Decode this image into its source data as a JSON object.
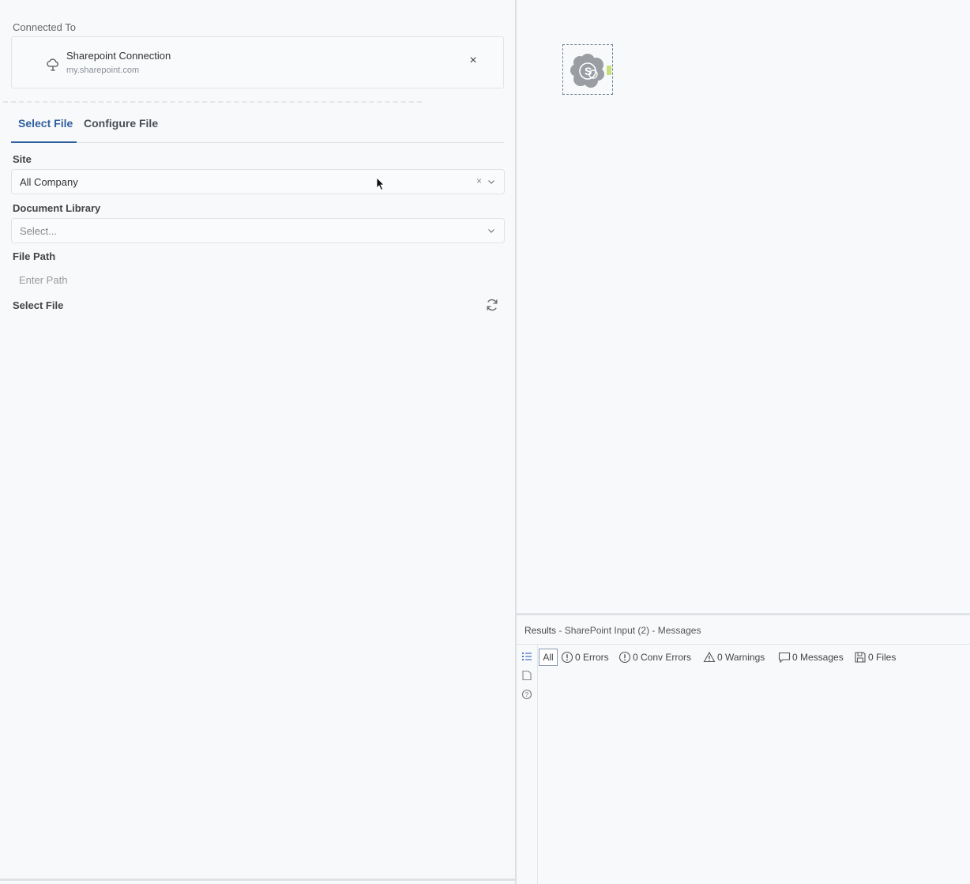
{
  "connection": {
    "section_label": "Connected To",
    "name": "Sharepoint Connection",
    "url": "my.sharepoint.com",
    "close_glyph": "×",
    "icon": "cloud-connection-icon"
  },
  "tabs": [
    {
      "label": "Select File",
      "active": true
    },
    {
      "label": "Configure File",
      "active": false
    }
  ],
  "form": {
    "site": {
      "label": "Site",
      "value": "All Company",
      "clear_glyph": "×"
    },
    "document_library": {
      "label": "Document Library",
      "placeholder": "Select..."
    },
    "file_path": {
      "label": "File Path",
      "placeholder": "Enter Path",
      "value": ""
    },
    "select_file": {
      "label": "Select File",
      "icon": "refresh-icon"
    }
  },
  "canvas": {
    "tool": {
      "name": "sharepoint-input-tool",
      "icon": "sharepoint-cloud-icon",
      "glyph": "S",
      "anchor_color": "#c8e07a"
    }
  },
  "results": {
    "title": "Results",
    "subtitle": "- SharePoint Input (2) - Messages",
    "filters": [
      {
        "key": "all",
        "label": "All",
        "icon": "none"
      },
      {
        "key": "errors",
        "label": "0 Errors",
        "icon": "error-circle-icon"
      },
      {
        "key": "conv_errors",
        "label": "0 Conv Errors",
        "icon": "conv-error-circle-icon"
      },
      {
        "key": "warnings",
        "label": "0 Warnings",
        "icon": "warning-triangle-icon"
      },
      {
        "key": "messages",
        "label": "0 Messages",
        "icon": "message-bubble-icon"
      },
      {
        "key": "files",
        "label": "0 Files",
        "icon": "save-disk-icon"
      }
    ]
  },
  "colors": {
    "accent": "#2f5f9e",
    "background": "#f8f9fb",
    "border": "#dfe2e6"
  }
}
